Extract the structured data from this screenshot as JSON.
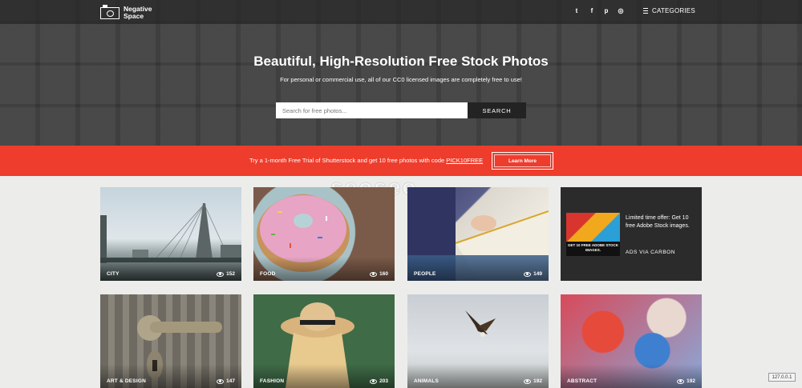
{
  "header": {
    "logo_line1": "Negative",
    "logo_line2": "Space",
    "social_icons": [
      "twitter-icon",
      "facebook-icon",
      "pinterest-icon",
      "instagram-icon"
    ],
    "social_glyphs": [
      "t",
      "f",
      "p",
      "◎"
    ],
    "categories_label": "CATEGORIES"
  },
  "hero": {
    "title": "Beautiful, High-Resolution Free Stock Photos",
    "subtitle": "For personal or commercial use, all of our CC0 licensed images are completely free to use!",
    "search_placeholder": "Search for free photos...",
    "search_button": "SEARCH"
  },
  "promo": {
    "text": "Try a 1-month Free Trial of Shutterstock and get 10 free photos with code ",
    "code": "PICK10FREE",
    "button": "Learn More"
  },
  "watermark": "seoseo",
  "categories": [
    {
      "label": "CITY",
      "views": "152"
    },
    {
      "label": "FOOD",
      "views": "160"
    },
    {
      "label": "PEOPLE",
      "views": "149"
    },
    {
      "label": "ART & DESIGN",
      "views": "147"
    },
    {
      "label": "FASHION",
      "views": "203"
    },
    {
      "label": "ANIMALS",
      "views": "192"
    },
    {
      "label": "ABSTRACT",
      "views": "192"
    }
  ],
  "ad": {
    "image_text": "GET 10 FREE ADOBE STOCK IMAGES.",
    "text": "Limited time offer: Get 10 free Adobe Stock images.",
    "via": "ADS VIA CARBON"
  },
  "badge": "127.0.0.1",
  "colors": {
    "promo_red": "#ee3d2c",
    "hero_dark": "#3c3c3c",
    "search_button": "#232323"
  }
}
